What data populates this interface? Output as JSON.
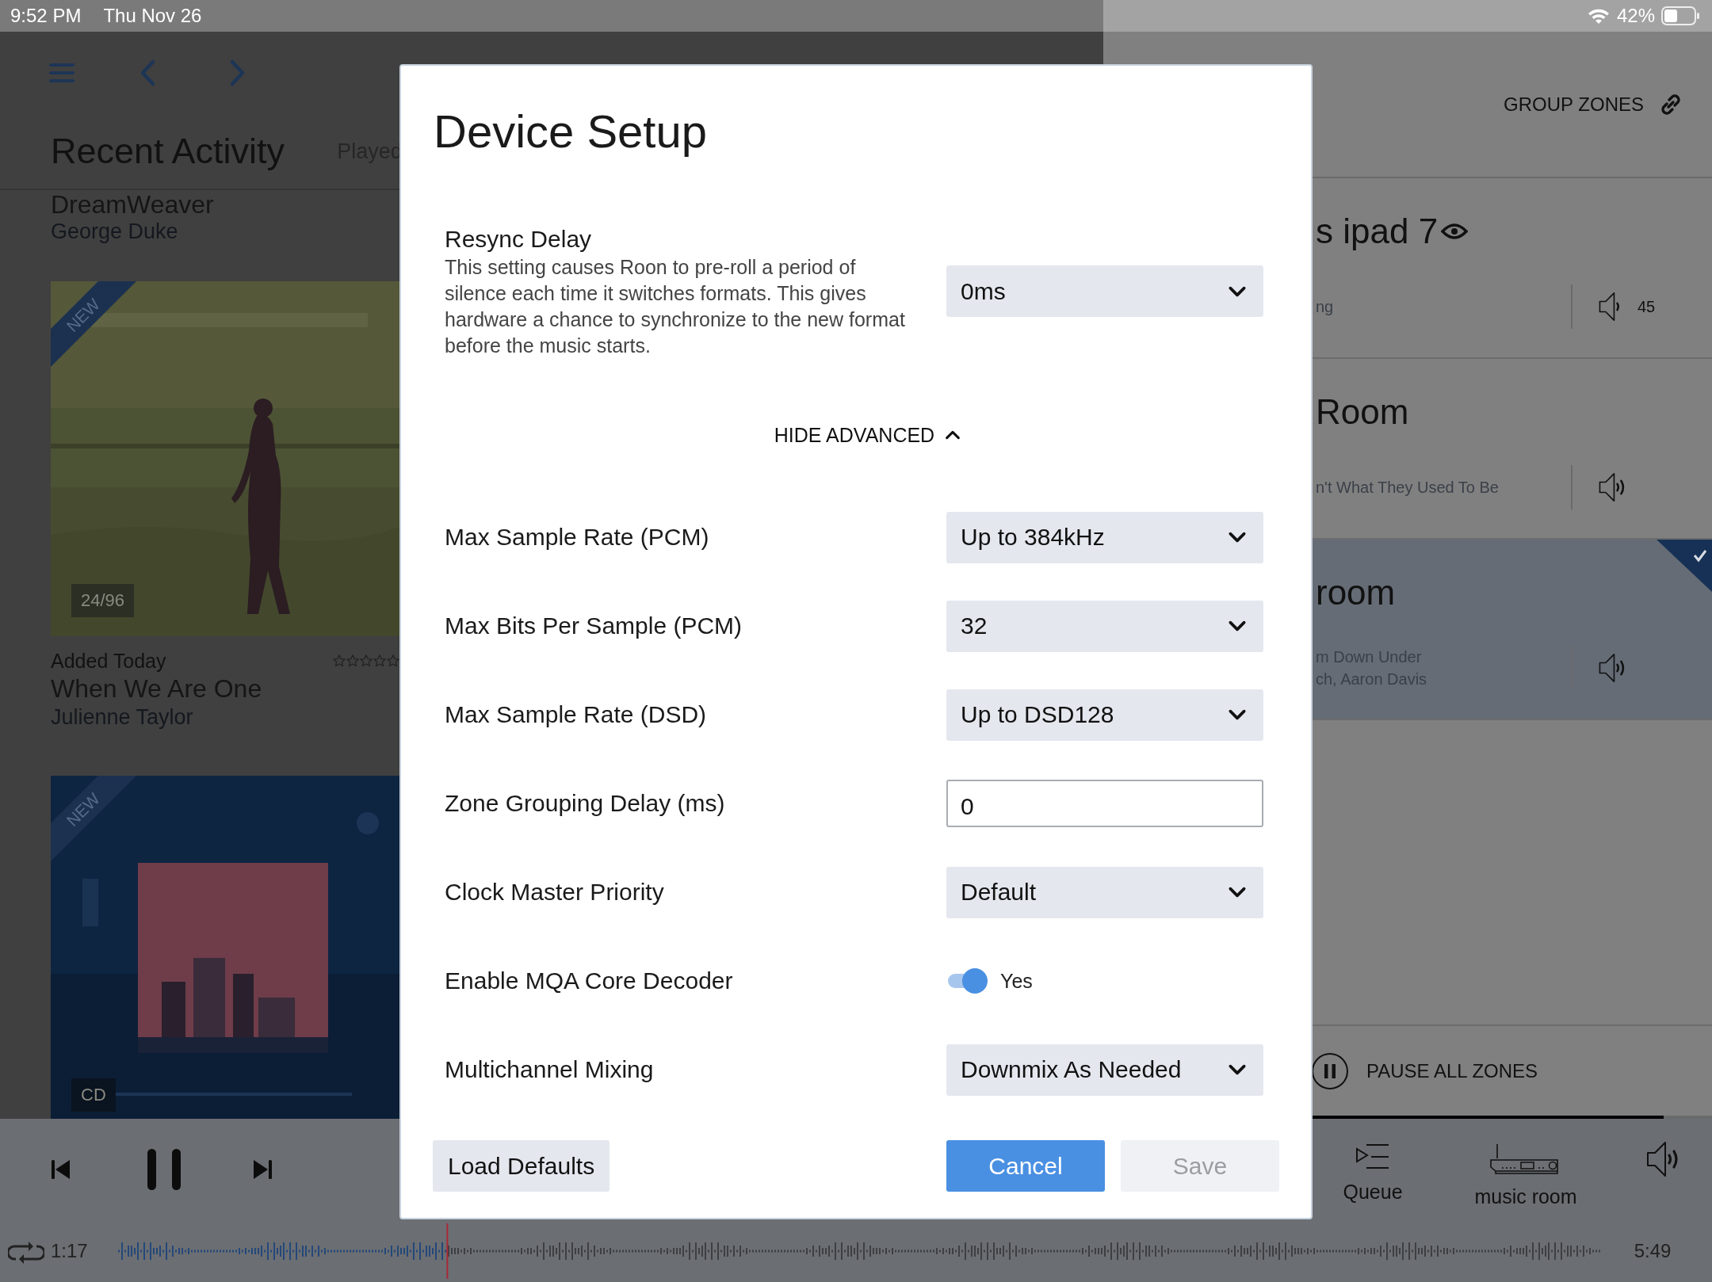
{
  "status_bar": {
    "time": "9:52 PM",
    "date": "Thu Nov 26",
    "battery": "42%"
  },
  "browse": {
    "title": "Recent Activity",
    "tab": "Played",
    "top_item": {
      "title": "DreamWeaver",
      "artist": "George Duke"
    },
    "albums": [
      {
        "kind": "picture",
        "ribbon": "NEW",
        "format": "24/96",
        "added": "Added Today",
        "stars": 0,
        "title": "When We Are One",
        "artist": "Julienne Taylor"
      },
      {
        "kind": "picture",
        "ribbon": "NEW",
        "format": "CD"
      }
    ]
  },
  "zones": {
    "header": "GROUP ZONES",
    "items": [
      {
        "name": "s ipad 7",
        "eye": true,
        "lines": [
          "ng"
        ],
        "volume": "45",
        "selected": false
      },
      {
        "name": "Room",
        "eye": false,
        "lines": [
          "n't What They Used To Be"
        ],
        "selected": false
      },
      {
        "name": "room",
        "eye": false,
        "lines": [
          "m Down Under",
          "ch, Aaron Davis"
        ],
        "selected": true
      }
    ],
    "pause_all": "PAUSE ALL ZONES",
    "progress": {
      "level": 0.92
    }
  },
  "player": {
    "elapsed": "1:17",
    "duration": "5:49",
    "seek": {
      "level": 0.222
    },
    "queue": "Queue",
    "zone": "music room"
  },
  "dialog": {
    "title": "Device Setup",
    "settings": [
      {
        "kind": "select",
        "label": "Resync Delay",
        "description": "This setting causes Roon to pre-roll a period of silence each time it switches formats. This gives hardware a chance to synchronize to the new format before the music starts.",
        "value": "0ms"
      }
    ],
    "advanced": {
      "label": "HIDE ADVANCED",
      "expanded": true
    },
    "advanced_settings": [
      {
        "kind": "select",
        "label": "Max Sample Rate (PCM)",
        "value": "Up to 384kHz"
      },
      {
        "kind": "select",
        "label": "Max Bits Per Sample (PCM)",
        "value": "32"
      },
      {
        "kind": "select",
        "label": "Max Sample Rate (DSD)",
        "value": "Up to DSD128"
      },
      {
        "kind": "input",
        "label": "Zone Grouping Delay (ms)",
        "value": "0"
      },
      {
        "kind": "select",
        "label": "Clock Master Priority",
        "value": "Default"
      },
      {
        "kind": "toggle",
        "label": "Enable MQA Core Decoder",
        "on": true,
        "value": "Yes"
      },
      {
        "kind": "select",
        "label": "Multichannel Mixing",
        "value": "Downmix As Needed"
      }
    ],
    "buttons": [
      {
        "label": "Load Defaults",
        "kind": "secondary",
        "disabled": false
      },
      {
        "label": "Cancel",
        "kind": "primary",
        "disabled": false
      },
      {
        "label": "Save",
        "kind": "secondary",
        "disabled": true
      }
    ]
  }
}
